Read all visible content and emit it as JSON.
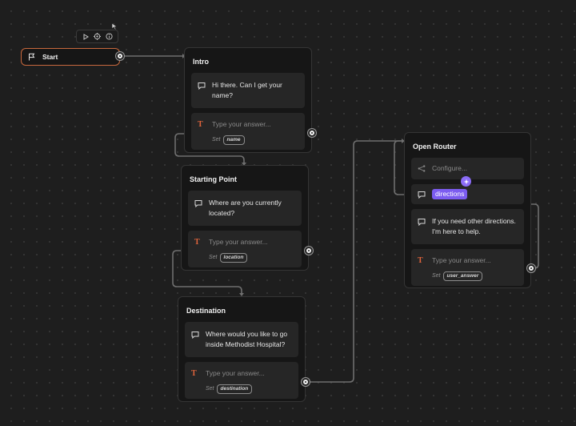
{
  "start": {
    "label": "Start"
  },
  "nodes": {
    "intro": {
      "title": "Intro",
      "message": "Hi there. Can I get your name?",
      "capture_placeholder": "Type your answer...",
      "set_label": "Set",
      "variable": "name"
    },
    "starting_point": {
      "title": "Starting Point",
      "message": "Where are you currently located?",
      "capture_placeholder": "Type your answer...",
      "set_label": "Set",
      "variable": "location"
    },
    "destination": {
      "title": "Destination",
      "message": "Where would you like to go inside Methodist Hospital?",
      "capture_placeholder": "Type your answer...",
      "set_label": "Set",
      "variable": "destination"
    },
    "open_router": {
      "title": "Open Router",
      "configure": "Configure...",
      "route_tag": "directions",
      "message": "If you need other directions. I'm here to help.",
      "capture_placeholder": "Type your answer...",
      "set_label": "Set",
      "variable": "user_answer"
    }
  },
  "icons": {
    "toolbar": [
      "play-icon",
      "target-icon",
      "info-icon"
    ],
    "message": "speech-bubble-icon",
    "capture": "text-t-icon",
    "router": "share-icon",
    "magic": "sparkle-icon"
  },
  "colors": {
    "canvas": "#1e1e1e",
    "node": "#161616",
    "step": "#262626",
    "start_border": "#c8683d",
    "capture_icon": "#e0643c",
    "route_tag": "#7c5cf0",
    "wire": "#6f6f6f"
  }
}
